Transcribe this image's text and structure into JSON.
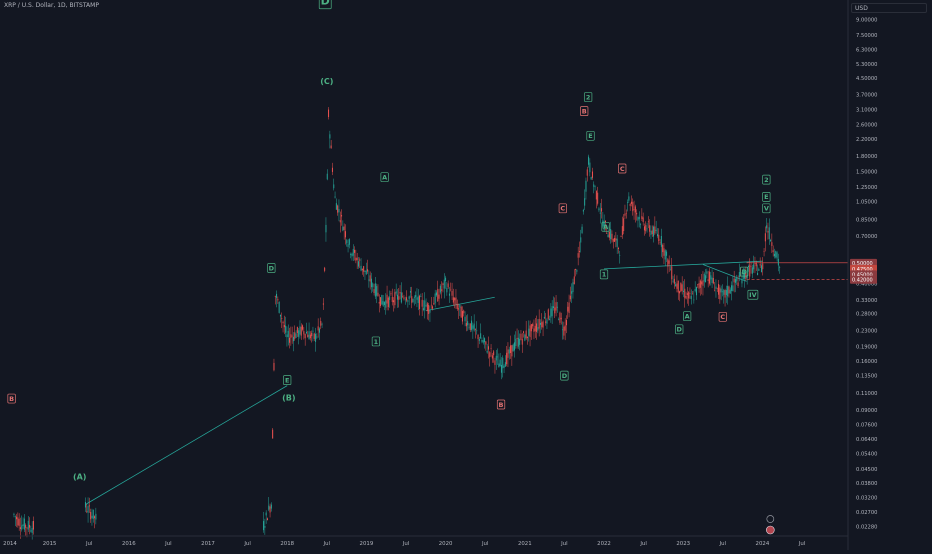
{
  "header": {
    "symbol_title": "XRP / U.S. Dollar, 1D, BITSTAMP",
    "currency": "USD"
  },
  "colors": {
    "background": "#131722",
    "bullish": "#26a69a",
    "bearish": "#ef5350",
    "wave_green": "#4caf83",
    "wave_red": "#e57373",
    "axis_text": "#b2b5be",
    "trendline": "#26a69a"
  },
  "chart_data": {
    "type": "candlestick",
    "y_scale": "log",
    "y_ticks": [
      "9.00000",
      "7.50000",
      "6.30000",
      "5.30000",
      "4.50000",
      "3.70000",
      "3.10000",
      "2.60000",
      "2.20000",
      "1.80000",
      "1.50000",
      "1.25000",
      "1.05000",
      "0.85000",
      "0.70000",
      "0.40000",
      "0.33000",
      "0.28000",
      "0.23000",
      "0.19000",
      "0.16000",
      "0.13500",
      "0.11000",
      "0.09000",
      "0.07600",
      "0.06400",
      "0.05400",
      "0.04500",
      "0.03800",
      "0.03200",
      "0.02700",
      "0.02280"
    ],
    "x_ticks": [
      "2014",
      "2015",
      "Jul",
      "2016",
      "Jul",
      "2017",
      "Jul",
      "2018",
      "Jul",
      "2019",
      "Jul",
      "2020",
      "Jul",
      "2021",
      "Jul",
      "2022",
      "Jul",
      "2023",
      "Jul",
      "2024",
      "Jul"
    ],
    "price_tags": [
      "0.50000",
      "0.47500",
      "0.45000",
      "0.42000"
    ],
    "price_path": [
      {
        "t": 2014.05,
        "p": 0.0262
      },
      {
        "t": 2014.15,
        "p": 0.0233
      },
      {
        "t": 2014.3,
        "p": 0.0226
      },
      {
        "t": 2014.95,
        "p": 0.0289
      },
      {
        "t": 2015.1,
        "p": 0.0245
      },
      {
        "t": 2017.2,
        "p": 0.0231
      },
      {
        "t": 2017.3,
        "p": 0.0302
      },
      {
        "t": 2017.35,
        "p": 0.36
      },
      {
        "t": 2017.5,
        "p": 0.21
      },
      {
        "t": 2017.7,
        "p": 0.23
      },
      {
        "t": 2017.85,
        "p": 0.21
      },
      {
        "t": 2017.95,
        "p": 0.25
      },
      {
        "t": 2018.0,
        "p": 1.0
      },
      {
        "t": 2018.02,
        "p": 3.0
      },
      {
        "t": 2018.1,
        "p": 1.1
      },
      {
        "t": 2018.3,
        "p": 0.6
      },
      {
        "t": 2018.5,
        "p": 0.45
      },
      {
        "t": 2018.7,
        "p": 0.32
      },
      {
        "t": 2019.0,
        "p": 0.35
      },
      {
        "t": 2019.3,
        "p": 0.3
      },
      {
        "t": 2019.5,
        "p": 0.4
      },
      {
        "t": 2019.7,
        "p": 0.28
      },
      {
        "t": 2019.9,
        "p": 0.22
      },
      {
        "t": 2020.2,
        "p": 0.15
      },
      {
        "t": 2020.4,
        "p": 0.2
      },
      {
        "t": 2020.7,
        "p": 0.25
      },
      {
        "t": 2020.9,
        "p": 0.3
      },
      {
        "t": 2021.0,
        "p": 0.23
      },
      {
        "t": 2021.2,
        "p": 0.6
      },
      {
        "t": 2021.3,
        "p": 1.7
      },
      {
        "t": 2021.5,
        "p": 0.8
      },
      {
        "t": 2021.7,
        "p": 0.6
      },
      {
        "t": 2021.8,
        "p": 1.1
      },
      {
        "t": 2022.0,
        "p": 0.8
      },
      {
        "t": 2022.2,
        "p": 0.7
      },
      {
        "t": 2022.4,
        "p": 0.4
      },
      {
        "t": 2022.6,
        "p": 0.33
      },
      {
        "t": 2022.8,
        "p": 0.45
      },
      {
        "t": 2023.0,
        "p": 0.34
      },
      {
        "t": 2023.2,
        "p": 0.42
      },
      {
        "t": 2023.35,
        "p": 0.47
      },
      {
        "t": 2023.5,
        "p": 0.48
      },
      {
        "t": 2023.55,
        "p": 0.8
      },
      {
        "t": 2023.65,
        "p": 0.6
      },
      {
        "t": 2023.72,
        "p": 0.48
      }
    ],
    "annotations": [
      {
        "text": "D",
        "t": 2017.98,
        "p": 11.2,
        "color": "green",
        "boxed": true
      },
      {
        "text": "(C)",
        "t": 2018.0,
        "p": 4.35,
        "color": "green",
        "boxed": false
      },
      {
        "text": "(B)",
        "t": 2017.52,
        "p": 0.104,
        "color": "green",
        "boxed": false
      },
      {
        "text": "(A)",
        "t": 2014.88,
        "p": 0.041,
        "color": "green",
        "boxed": false
      },
      {
        "text": "B",
        "t": 2014.02,
        "p": 0.103,
        "color": "red",
        "boxed": true
      },
      {
        "text": "A",
        "t": 2018.73,
        "p": 1.4,
        "color": "green",
        "boxed": true
      },
      {
        "text": "D",
        "t": 2017.3,
        "p": 0.48,
        "color": "green",
        "boxed": true
      },
      {
        "text": "E",
        "t": 2017.5,
        "p": 0.128,
        "color": "green",
        "boxed": true
      },
      {
        "text": "1",
        "t": 2018.62,
        "p": 0.202,
        "color": "green",
        "boxed": true
      },
      {
        "text": "2",
        "t": 2021.3,
        "p": 3.6,
        "color": "green",
        "boxed": true
      },
      {
        "text": "B",
        "t": 2021.25,
        "p": 3.05,
        "color": "red",
        "boxed": true
      },
      {
        "text": "E",
        "t": 2021.33,
        "p": 2.28,
        "color": "green",
        "boxed": true
      },
      {
        "text": "C",
        "t": 2021.73,
        "p": 1.55,
        "color": "red",
        "boxed": true
      },
      {
        "text": "C",
        "t": 2020.98,
        "p": 0.97,
        "color": "red",
        "boxed": true
      },
      {
        "text": "A",
        "t": 2021.52,
        "p": 0.78,
        "color": "green",
        "boxed": true
      },
      {
        "text": "1",
        "t": 2021.5,
        "p": 0.445,
        "color": "green",
        "boxed": true
      },
      {
        "text": "D",
        "t": 2021.0,
        "p": 0.135,
        "color": "green",
        "boxed": true
      },
      {
        "text": "B",
        "t": 2020.2,
        "p": 0.096,
        "color": "red",
        "boxed": true
      },
      {
        "text": "D",
        "t": 2022.45,
        "p": 0.233,
        "color": "green",
        "boxed": true
      },
      {
        "text": "A",
        "t": 2022.55,
        "p": 0.272,
        "color": "green",
        "boxed": true
      },
      {
        "text": "C",
        "t": 2023.0,
        "p": 0.27,
        "color": "red",
        "boxed": true
      },
      {
        "text": "D",
        "t": 2023.27,
        "p": 0.46,
        "color": "green",
        "boxed": true
      },
      {
        "text": "2",
        "t": 2023.55,
        "p": 1.36,
        "color": "green",
        "boxed": true
      },
      {
        "text": "E",
        "t": 2023.55,
        "p": 1.11,
        "color": "green",
        "boxed": true
      },
      {
        "text": "V",
        "t": 2023.55,
        "p": 0.97,
        "color": "green",
        "boxed": true
      },
      {
        "text": "IV",
        "t": 2023.38,
        "p": 0.35,
        "color": "green",
        "boxed": true
      }
    ],
    "trendlines": [
      {
        "t1": 2014.95,
        "p1": 0.0295,
        "t2": 2017.5,
        "p2": 0.12
      },
      {
        "t1": 2019.25,
        "p1": 0.29,
        "t2": 2020.12,
        "p2": 0.34
      },
      {
        "t1": 2021.5,
        "p1": 0.475,
        "t2": 2023.5,
        "p2": 0.52
      },
      {
        "t1": 2022.75,
        "p1": 0.5,
        "t2": 2023.3,
        "p2": 0.41
      }
    ],
    "h_lines": [
      {
        "p": 0.51,
        "dashed": false
      },
      {
        "p": 0.418,
        "dashed": true
      }
    ]
  }
}
